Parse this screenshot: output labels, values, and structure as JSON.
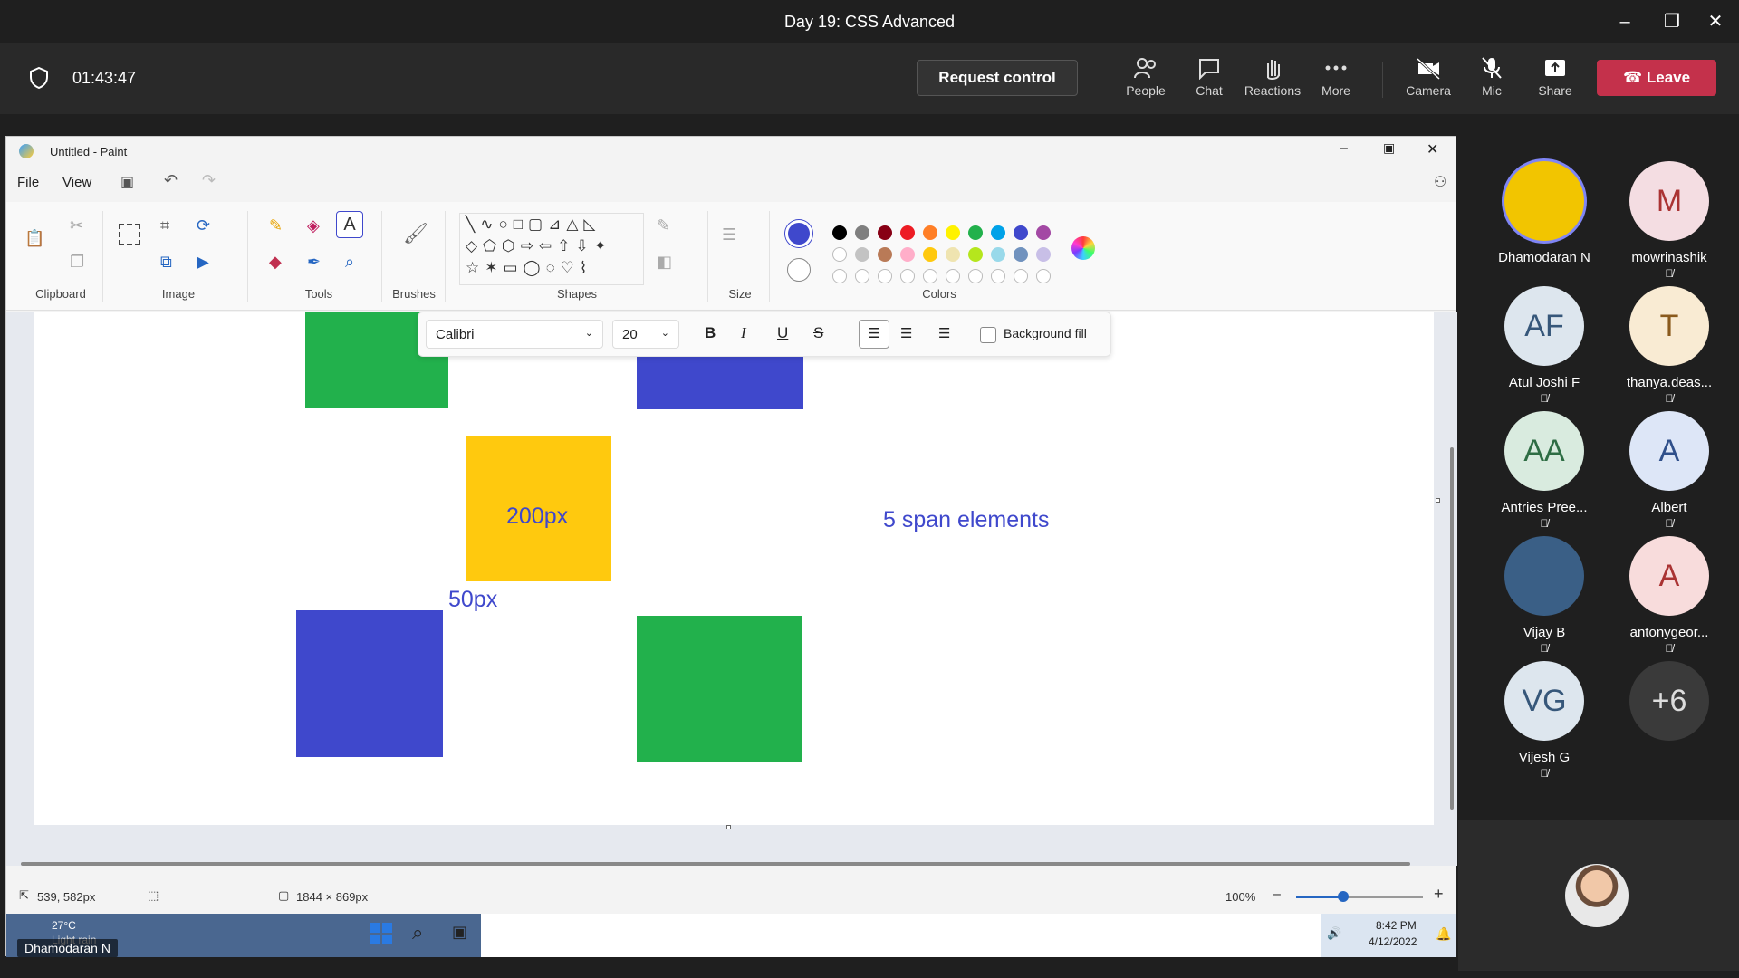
{
  "window": {
    "title": "Day 19: CSS Advanced"
  },
  "meeting": {
    "timer": "01:43:47",
    "request_control": "Request control",
    "buttons": {
      "people": "People",
      "chat": "Chat",
      "reactions": "Reactions",
      "more": "More",
      "camera": "Camera",
      "mic": "Mic",
      "share": "Share"
    },
    "leave": "Leave",
    "accent": "#c4314b"
  },
  "paint": {
    "title": "Untitled - Paint",
    "menu": {
      "file": "File",
      "view": "View"
    },
    "groups": {
      "clipboard": "Clipboard",
      "image": "Image",
      "tools": "Tools",
      "brushes": "Brushes",
      "shapes": "Shapes",
      "size": "Size",
      "colors": "Colors"
    },
    "textbar": {
      "font": "Calibri",
      "size": "20",
      "background_fill": "Background fill"
    },
    "canvas_text": {
      "t200": "200px",
      "t50": "50px",
      "spans": "5 span elements"
    },
    "colors": {
      "green": "#22b14c",
      "blue": "#3f48cc",
      "yellow": "#ffc90e",
      "text": "#3f48cc"
    },
    "palette_row1": [
      "#000000",
      "#7f7f7f",
      "#880015",
      "#ed1c24",
      "#ff7f27",
      "#fff200",
      "#22b14c",
      "#00a2e8",
      "#3f48cc",
      "#a349a4"
    ],
    "palette_row2": [
      "#ffffff",
      "#c3c3c3",
      "#b97a57",
      "#ffaec9",
      "#ffc90e",
      "#efe4b0",
      "#b5e61d",
      "#99d9ea",
      "#7092be",
      "#c8bfe7"
    ],
    "status": {
      "cursor": "539, 582px",
      "size": "1844 × 869px",
      "zoom": "100%"
    }
  },
  "taskbar": {
    "weather_temp": "27°C",
    "weather_desc": "Light rain",
    "time": "8:42 PM",
    "date": "4/12/2022",
    "presenter": "Dhamodaran N"
  },
  "participants": [
    {
      "initials": "",
      "name": "Dhamodaran N",
      "bg": "#f2c500",
      "fg": "#000"
    },
    {
      "initials": "M",
      "name": "mowrinashik",
      "bg": "#f4dde2",
      "fg": "#a33"
    },
    {
      "initials": "AF",
      "name": "Atul Joshi F",
      "bg": "#dde6ee",
      "fg": "#36577a"
    },
    {
      "initials": "T",
      "name": "thanya.deas...",
      "bg": "#f9ebd3",
      "fg": "#8a5a1d"
    },
    {
      "initials": "AA",
      "name": "Antries Pree...",
      "bg": "#d9ebdf",
      "fg": "#2e6d44"
    },
    {
      "initials": "A",
      "name": "Albert",
      "bg": "#dde6f7",
      "fg": "#2f4f8a"
    },
    {
      "initials": "",
      "name": "Vijay B",
      "bg": "#3a5f86",
      "fg": "#fff"
    },
    {
      "initials": "A",
      "name": "antonygeor...",
      "bg": "#f8dcdc",
      "fg": "#a33"
    },
    {
      "initials": "VG",
      "name": "Vijesh G",
      "bg": "#dde6ee",
      "fg": "#36577a"
    },
    {
      "initials": "+6",
      "name": "",
      "bg": "#3a3a3a",
      "fg": "#ddd"
    }
  ]
}
